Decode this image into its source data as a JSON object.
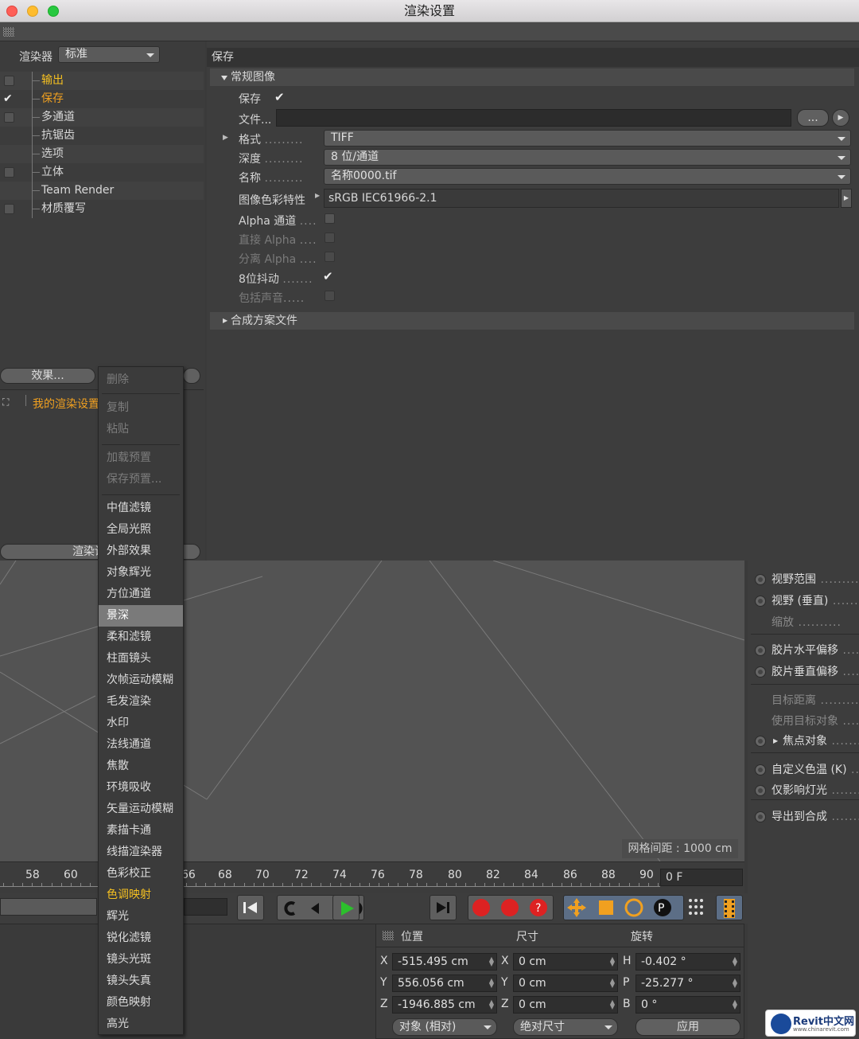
{
  "window": {
    "title": "渲染设置"
  },
  "left": {
    "renderer_label": "渲染器",
    "renderer_value": "标准",
    "tree": [
      {
        "label": "输出",
        "checked": false,
        "state": "highlight"
      },
      {
        "label": "保存",
        "checked": true,
        "state": "active"
      },
      {
        "label": "多通道",
        "checked": false,
        "state": "normal"
      },
      {
        "label": "抗锯齿",
        "checked": null,
        "state": "normal"
      },
      {
        "label": "选项",
        "checked": null,
        "state": "normal"
      },
      {
        "label": "立体",
        "checked": false,
        "state": "normal"
      },
      {
        "label": "Team Render",
        "checked": null,
        "state": "normal"
      },
      {
        "label": "材质覆写",
        "checked": false,
        "state": "normal"
      }
    ],
    "effects_button": "效果...",
    "setting_item": "我的渲染设置",
    "render_button": "渲染设"
  },
  "save_panel": {
    "header": "保存",
    "section_general": "常规图像",
    "save_label": "保存",
    "file_label": "文件...",
    "file_value": "",
    "browse_button": "...",
    "format_label": "格式",
    "format_value": "TIFF",
    "depth_label": "深度",
    "depth_value": "8 位/通道",
    "name_label": "名称",
    "name_value": "名称0000.tif",
    "color_profile_label": "图像色彩特性",
    "color_profile_value": "sRGB IEC61966-2.1",
    "alpha_label": "Alpha 通道",
    "straight_alpha_label": "直接 Alpha",
    "separate_alpha_label": "分离 Alpha",
    "dither_label": "8位抖动",
    "sound_label": "包括声音",
    "section_compositing": "合成方案文件"
  },
  "context_menu": {
    "items": [
      {
        "label": "删除",
        "disabled": true
      },
      {
        "label": "复制",
        "disabled": true
      },
      {
        "label": "粘贴",
        "disabled": true
      },
      {
        "label": "加载预置",
        "disabled": true
      },
      {
        "label": "保存预置...",
        "disabled": true
      },
      {
        "label": "中值滤镜",
        "disabled": false
      },
      {
        "label": "全局光照",
        "disabled": false
      },
      {
        "label": "外部效果",
        "disabled": false
      },
      {
        "label": "对象辉光",
        "disabled": false
      },
      {
        "label": "方位通道",
        "disabled": false
      },
      {
        "label": "景深",
        "disabled": false,
        "hover": true
      },
      {
        "label": "柔和滤镜",
        "disabled": false
      },
      {
        "label": "柱面镜头",
        "disabled": false
      },
      {
        "label": "次帧运动模糊",
        "disabled": false
      },
      {
        "label": "毛发渲染",
        "disabled": false
      },
      {
        "label": "水印",
        "disabled": false
      },
      {
        "label": "法线通道",
        "disabled": false
      },
      {
        "label": "焦散",
        "disabled": false
      },
      {
        "label": "环境吸收",
        "disabled": false
      },
      {
        "label": "矢量运动模糊",
        "disabled": false
      },
      {
        "label": "素描卡通",
        "disabled": false
      },
      {
        "label": "线描渲染器",
        "disabled": false
      },
      {
        "label": "色彩校正",
        "disabled": false
      },
      {
        "label": "色调映射",
        "disabled": false,
        "accent": true
      },
      {
        "label": "辉光",
        "disabled": false
      },
      {
        "label": "锐化滤镜",
        "disabled": false
      },
      {
        "label": "镜头光斑",
        "disabled": false
      },
      {
        "label": "镜头失真",
        "disabled": false
      },
      {
        "label": "颜色映射",
        "disabled": false
      },
      {
        "label": "高光",
        "disabled": false
      }
    ]
  },
  "viewport": {
    "grid_spacing": "网格间距 : 1000 cm"
  },
  "attributes": {
    "items": [
      {
        "label": "视野范围",
        "radio": true
      },
      {
        "label": "视野 (垂直)",
        "radio": true
      },
      {
        "label": "缩放",
        "radio": false,
        "dim": true
      },
      {
        "label": "胶片水平偏移",
        "radio": true
      },
      {
        "label": "胶片垂直偏移",
        "radio": true
      },
      {
        "label": "目标距离",
        "radio": false,
        "dim": true
      },
      {
        "label": "使用目标对象",
        "radio": false,
        "dim": true
      },
      {
        "label": "焦点对象",
        "radio": true,
        "arrow": true
      },
      {
        "label": "自定义色温 (K)",
        "radio": true
      },
      {
        "label": "仅影响灯光",
        "radio": true
      },
      {
        "label": "导出到合成",
        "radio": true
      }
    ]
  },
  "timeline": {
    "ticks": [
      "58",
      "60",
      "66",
      "68",
      "70",
      "72",
      "74",
      "76",
      "78",
      "80",
      "82",
      "84",
      "86",
      "88",
      "90"
    ],
    "frame_value": "0 F"
  },
  "coords": {
    "position_label": "位置",
    "size_label": "尺寸",
    "rotation_label": "旋转",
    "x_pos": "-515.495 cm",
    "y_pos": "556.056 cm",
    "z_pos": "-1946.885 cm",
    "x_size": "0 cm",
    "y_size": "0 cm",
    "z_size": "0 cm",
    "h_rot": "-0.402 °",
    "p_rot": "-25.277 °",
    "b_rot": "0 °",
    "axis_x": "X",
    "axis_y": "Y",
    "axis_z": "Z",
    "axis_h": "H",
    "axis_p": "P",
    "axis_b": "B",
    "mode_object": "对象 (相对)",
    "mode_size": "绝对尺寸",
    "apply_button": "应用"
  },
  "watermark": {
    "brand": "Revit中文网",
    "url": "www.chinarevit.com"
  },
  "colors": {
    "accent": "#f0a020",
    "highlight": "#f5c020",
    "panel": "#3d3d3d"
  }
}
